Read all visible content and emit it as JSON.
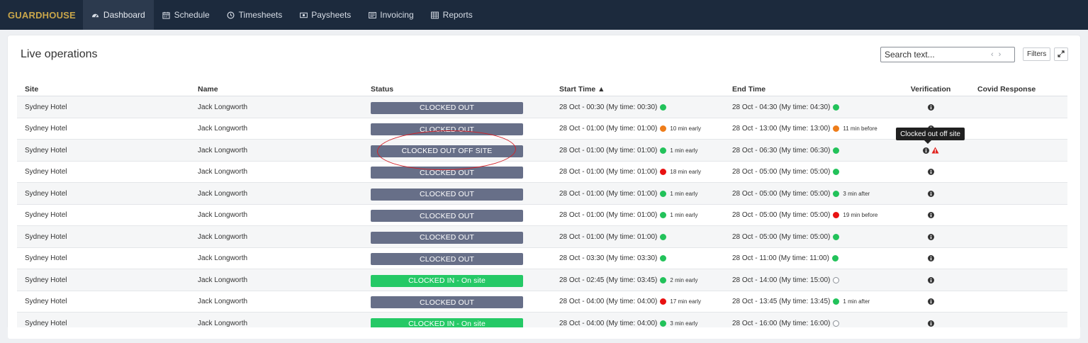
{
  "brand": "GUARDHOUSE",
  "nav": [
    {
      "label": "Dashboard",
      "icon": "tachometer-icon",
      "active": true
    },
    {
      "label": "Schedule",
      "icon": "calendar-icon",
      "active": false
    },
    {
      "label": "Timesheets",
      "icon": "clock-icon",
      "active": false
    },
    {
      "label": "Paysheets",
      "icon": "money-icon",
      "active": false
    },
    {
      "label": "Invoicing",
      "icon": "invoice-icon",
      "active": false
    },
    {
      "label": "Reports",
      "icon": "table-icon",
      "active": false
    }
  ],
  "panel": {
    "title": "Live operations",
    "search_placeholder": "Search text...",
    "search_prev": "‹",
    "search_next": "›",
    "filters_label": "Filters"
  },
  "table": {
    "headers": {
      "site": "Site",
      "name": "Name",
      "status": "Status",
      "start": "Start Time ▲",
      "end": "End Time",
      "verification": "Verification",
      "covid": "Covid Response"
    },
    "rows": [
      {
        "site": "Sydney Hotel",
        "name": "Jack Longworth",
        "status": "CLOCKED OUT",
        "status_kind": "out",
        "start": "28 Oct - 00:30 (My time: 00:30)",
        "start_dot": "green",
        "start_note": "",
        "end": "28 Oct - 04:30 (My time: 04:30)",
        "end_dot": "green",
        "end_note": "",
        "warn": false
      },
      {
        "site": "Sydney Hotel",
        "name": "Jack Longworth",
        "status": "CLOCKED OUT",
        "status_kind": "out",
        "start": "28 Oct - 01:00 (My time: 01:00)",
        "start_dot": "orange",
        "start_note": "10 min early",
        "end": "28 Oct - 13:00 (My time: 13:00)",
        "end_dot": "orange",
        "end_note": "11 min before",
        "warn": false
      },
      {
        "site": "Sydney Hotel",
        "name": "Jack Longworth",
        "status": "CLOCKED OUT OFF SITE",
        "status_kind": "out",
        "start": "28 Oct - 01:00 (My time: 01:00)",
        "start_dot": "green",
        "start_note": "1 min early",
        "end": "28 Oct - 06:30 (My time: 06:30)",
        "end_dot": "green",
        "end_note": "",
        "warn": true
      },
      {
        "site": "Sydney Hotel",
        "name": "Jack Longworth",
        "status": "CLOCKED OUT",
        "status_kind": "out",
        "start": "28 Oct - 01:00 (My time: 01:00)",
        "start_dot": "red",
        "start_note": "18 min early",
        "end": "28 Oct - 05:00 (My time: 05:00)",
        "end_dot": "green",
        "end_note": "",
        "warn": false
      },
      {
        "site": "Sydney Hotel",
        "name": "Jack Longworth",
        "status": "CLOCKED OUT",
        "status_kind": "out",
        "start": "28 Oct - 01:00 (My time: 01:00)",
        "start_dot": "green",
        "start_note": "1 min early",
        "end": "28 Oct - 05:00 (My time: 05:00)",
        "end_dot": "green",
        "end_note": "3 min after",
        "warn": false
      },
      {
        "site": "Sydney Hotel",
        "name": "Jack Longworth",
        "status": "CLOCKED OUT",
        "status_kind": "out",
        "start": "28 Oct - 01:00 (My time: 01:00)",
        "start_dot": "green",
        "start_note": "1 min early",
        "end": "28 Oct - 05:00 (My time: 05:00)",
        "end_dot": "red",
        "end_note": "19 min before",
        "warn": false
      },
      {
        "site": "Sydney Hotel",
        "name": "Jack Longworth",
        "status": "CLOCKED OUT",
        "status_kind": "out",
        "start": "28 Oct - 01:00 (My time: 01:00)",
        "start_dot": "green",
        "start_note": "",
        "end": "28 Oct - 05:00 (My time: 05:00)",
        "end_dot": "green",
        "end_note": "",
        "warn": false
      },
      {
        "site": "Sydney Hotel",
        "name": "Jack Longworth",
        "status": "CLOCKED OUT",
        "status_kind": "out",
        "start": "28 Oct - 03:30 (My time: 03:30)",
        "start_dot": "green",
        "start_note": "",
        "end": "28 Oct - 11:00 (My time: 11:00)",
        "end_dot": "green",
        "end_note": "",
        "warn": false
      },
      {
        "site": "Sydney Hotel",
        "name": "Jack Longworth",
        "status": "CLOCKED IN - On site",
        "status_kind": "in",
        "start": "28 Oct - 02:45 (My time: 03:45)",
        "start_dot": "green",
        "start_note": "2 min early",
        "end": "28 Oct - 14:00 (My time: 15:00)",
        "end_dot": "empty",
        "end_note": "",
        "warn": false
      },
      {
        "site": "Sydney Hotel",
        "name": "Jack Longworth",
        "status": "CLOCKED OUT",
        "status_kind": "out",
        "start": "28 Oct - 04:00 (My time: 04:00)",
        "start_dot": "red",
        "start_note": "17 min early",
        "end": "28 Oct - 13:45 (My time: 13:45)",
        "end_dot": "green",
        "end_note": "1 min after",
        "warn": false
      },
      {
        "site": "Sydney Hotel",
        "name": "Jack Longworth",
        "status": "CLOCKED IN - On site",
        "status_kind": "in",
        "start": "28 Oct - 04:00 (My time: 04:00)",
        "start_dot": "green",
        "start_note": "3 min early",
        "end": "28 Oct - 16:00 (My time: 16:00)",
        "end_dot": "empty",
        "end_note": "",
        "warn": false
      }
    ]
  },
  "tooltip": "Clocked out off site",
  "colors": {
    "navbar": "#1c2a3d",
    "brand": "#c9a64a",
    "badge_out": "#676f88",
    "badge_in": "#25c966",
    "dot_green": "#22c25a",
    "dot_orange": "#ee7d1a",
    "dot_red": "#e81212",
    "annotation": "#d2232a"
  }
}
